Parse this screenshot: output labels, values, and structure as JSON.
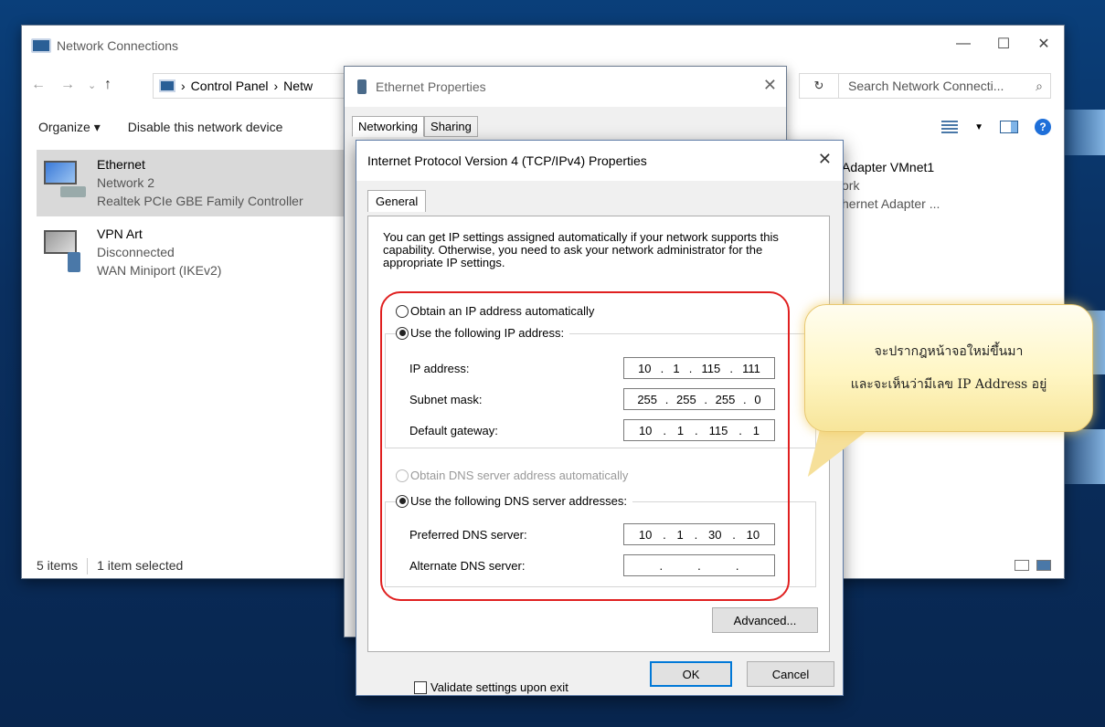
{
  "explorer": {
    "title": "Network Connections",
    "breadcrumb": [
      "Control Panel",
      "Netw"
    ],
    "search_placeholder": "Search Network Connecti...",
    "toolbar": {
      "organize": "Organize ▾",
      "disable": "Disable this network device"
    },
    "items": [
      {
        "name": "Ethernet",
        "network": "Network 2",
        "adapter": "Realtek PCIe GBE Family Controller"
      },
      {
        "name": "VPN Art",
        "network": "Disconnected",
        "adapter": "WAN Miniport (IKEv2)"
      }
    ],
    "partial_item": {
      "name": "Adapter VMnet1",
      "network": "ork",
      "adapter": "hernet Adapter ..."
    },
    "status": {
      "count": "5 items",
      "selected": "1 item selected"
    }
  },
  "ethernet_properties": {
    "title": "Ethernet Properties",
    "tabs": [
      "Networking",
      "Sharing"
    ]
  },
  "ipv4": {
    "title": "Internet Protocol Version 4 (TCP/IPv4) Properties",
    "tab": "General",
    "intro": "You can get IP settings assigned automatically if your network supports this capability. Otherwise, you need to ask your network administrator for the appropriate IP settings.",
    "ip_auto": "Obtain an IP address automatically",
    "ip_manual": "Use the following IP address:",
    "ip_address_label": "IP address:",
    "ip_address": [
      "10",
      "1",
      "115",
      "111"
    ],
    "subnet_label": "Subnet mask:",
    "subnet": [
      "255",
      "255",
      "255",
      "0"
    ],
    "gateway_label": "Default gateway:",
    "gateway": [
      "10",
      "1",
      "115",
      "1"
    ],
    "dns_auto": "Obtain DNS server address automatically",
    "dns_manual": "Use the following DNS server addresses:",
    "preferred_label": "Preferred DNS server:",
    "preferred": [
      "10",
      "1",
      "30",
      "10"
    ],
    "alternate_label": "Alternate DNS server:",
    "validate": "Validate settings upon exit",
    "advanced": "Advanced...",
    "ok": "OK",
    "cancel": "Cancel"
  },
  "callout": {
    "line1": "จะปรากฎหน้าจอใหม่ขึ้นมา",
    "line2": "และจะเห็นว่ามีเลข IP Address อยู่"
  }
}
